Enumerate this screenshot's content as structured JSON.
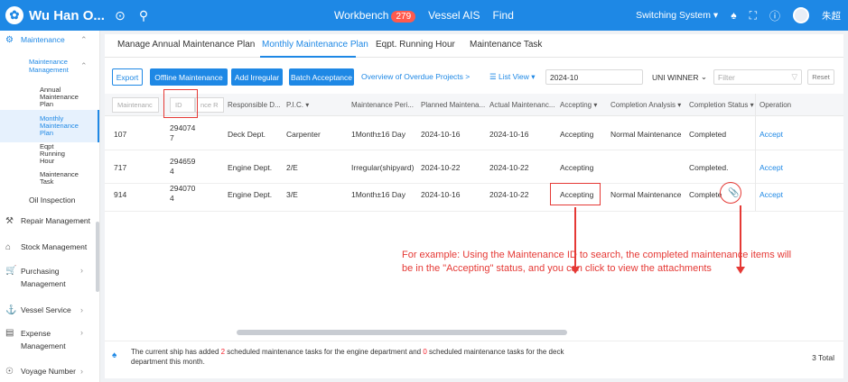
{
  "topbar": {
    "app_title": "Wu Han O...",
    "nav": [
      {
        "label": "Workbench",
        "badge": "279"
      },
      {
        "label": "Vessel AIS"
      },
      {
        "label": "Find"
      }
    ],
    "system_label": "Switching System",
    "user_name": "朱超"
  },
  "sidebar": {
    "items": [
      {
        "label": "Maintenance"
      },
      {
        "label": "Maintenance Management"
      },
      {
        "label": "Annual Maintenance Plan"
      },
      {
        "label": "Monthly Maintenance Plan"
      },
      {
        "label": "Eqpt Running Hour"
      },
      {
        "label": "Maintenance Task"
      },
      {
        "label": "Oil Inspection"
      },
      {
        "label": "Repair Management"
      },
      {
        "label": "Stock Management"
      },
      {
        "label": "Purchasing Management"
      },
      {
        "label": "Vessel Service"
      },
      {
        "label": "Expense Management"
      },
      {
        "label": "Voyage Number"
      }
    ]
  },
  "tabs": [
    "Manage Annual Maintenance Plan",
    "Monthly Maintenance Plan",
    "Eqpt. Running Hour",
    "Maintenance Task"
  ],
  "toolbar": {
    "export": "Export",
    "offline": "Offline Maintenance",
    "add_irregular": "Add Irregular",
    "batch": "Batch Acceptance",
    "overdue_link": "Overview of Overdue Projects >",
    "list_view": "List View",
    "month": "2024-10",
    "ship": "UNI WINNER",
    "filter_placeholder": "Filter",
    "reset": "Reset"
  },
  "table": {
    "filter_placeholders": [
      "Maintenanc",
      "ID",
      "nce R"
    ],
    "headers": [
      "Responsible D...",
      "P.I.C.",
      "Maintenance Peri...",
      "Planned Maintena...",
      "Actual Maintenanc...",
      "Accepting",
      "Completion Analysis",
      "Completion Status",
      "Operation"
    ],
    "rows": [
      {
        "code": "107",
        "id": "2940747",
        "dept": "Deck Dept.",
        "pic": "Carpenter",
        "period": "1Month±16 Day",
        "planned": "2024-10-16",
        "actual": "2024-10-16",
        "accepting": "Accepting",
        "analysis": "Normal Maintenance",
        "status": "Completed",
        "op": "Accept"
      },
      {
        "code": "717",
        "id": "2946594",
        "dept": "Engine Dept.",
        "pic": "2/E",
        "period": "Irregular(shipyard)",
        "planned": "2024-10-22",
        "actual": "2024-10-22",
        "accepting": "Accepting",
        "analysis": "",
        "status": "Completed.",
        "op": "Accept"
      },
      {
        "code": "914",
        "id": "2940704",
        "dept": "Engine Dept.",
        "pic": "3/E",
        "period": "1Month±16 Day",
        "planned": "2024-10-16",
        "actual": "2024-10-22",
        "accepting": "Accepting",
        "analysis": "Normal Maintenance",
        "status": "Complete",
        "op": "Accept"
      }
    ]
  },
  "footer": {
    "text_1": "The current ship has added ",
    "count_engine": "2",
    "text_2": " scheduled maintenance tasks for the engine department and ",
    "count_deck": "0",
    "text_3": " scheduled maintenance tasks for the deck department this month.",
    "total": "3 Total"
  },
  "annotation": {
    "text": "For example: Using the Maintenance ID to search,  the completed maintenance items will be in the \"Accepting\" status, and you can click to view the attachments"
  },
  "colors": {
    "primary": "#1e88e5",
    "annotation": "#e53935",
    "badge": "#ff5a4e"
  }
}
